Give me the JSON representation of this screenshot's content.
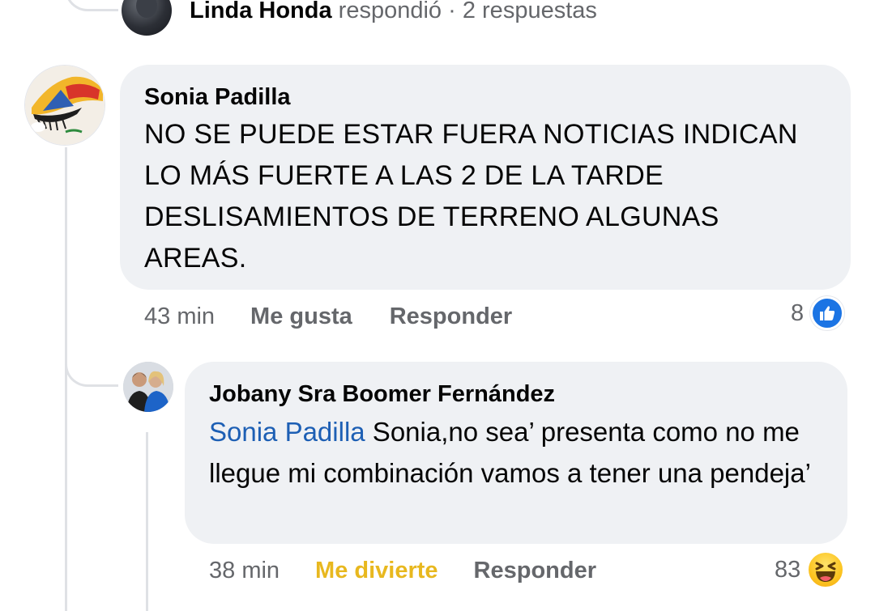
{
  "top_reply": {
    "author": "Linda Honda",
    "action": "respondió",
    "separator": "·",
    "replies": "2 respuestas"
  },
  "comments": [
    {
      "author": "Sonia Padilla",
      "text": "NO SE PUEDE ESTAR FUERA NOTICIAS INDICAN LO MÁS FUERTE A LAS 2 DE LA TARDE DESLISAMIENTOS DE TERRENO ALGUNAS AREAS.",
      "time": "43 min",
      "reaction_label": "Me gusta",
      "reply_label": "Responder",
      "reaction_count": "8",
      "reaction_icon": "like-icon"
    },
    {
      "author": "Jobany Sra Boomer Fernández",
      "mention": "Sonia Padilla",
      "text": " Sonia,no sea’ presenta como no me llegue mi combinación vamos a tener una pendeja’",
      "time": "38 min",
      "reaction_label": "Me divierte",
      "reply_label": "Responder",
      "reaction_count": "83",
      "reaction_icon": "haha-icon"
    }
  ],
  "colors": {
    "bubble": "#eff1f4",
    "mention": "#1d5fb4",
    "like": "#1b74e4",
    "haha": "#e8b81f",
    "meta": "#65676b"
  }
}
